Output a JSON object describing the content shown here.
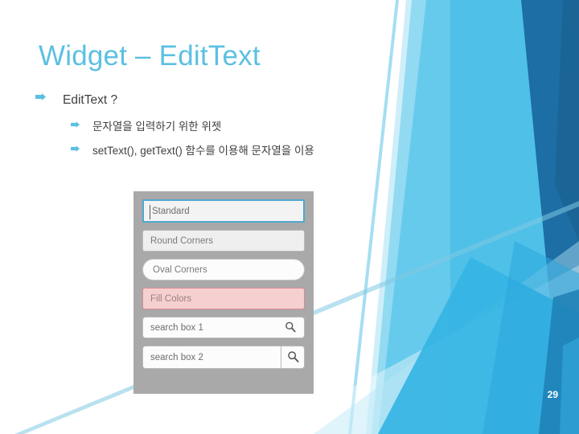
{
  "slide": {
    "title": "Widget – EditText",
    "page_number": "29",
    "title_color": "#5CC0E2",
    "accent_color": "#5CC0E2"
  },
  "bullets": [
    {
      "level": 1,
      "text": "EditText ?",
      "marker": "arrow-right-icon"
    },
    {
      "level": 2,
      "text": "문자열을 입력하기 위한 위젯",
      "marker": "arrow-right-icon"
    },
    {
      "level": 2,
      "text": "setText(), getText() 함수를 이용해 문자열을 이용",
      "marker": "arrow-right-icon"
    }
  ],
  "android_screenshot": {
    "panel_color": "#a9a9a9",
    "fields": [
      {
        "id": "standard",
        "label": "Standard",
        "style": "standard",
        "border_color": "#4fa8d0",
        "fill_color": "#f3f3f3",
        "has_caret": true,
        "has_search_icon": false
      },
      {
        "id": "round-corners",
        "label": "Round Corners",
        "style": "round",
        "border_color": "#b9b9b9",
        "fill_color": "#efefef",
        "has_caret": false,
        "has_search_icon": false
      },
      {
        "id": "oval-corners",
        "label": "Oval Corners",
        "style": "oval",
        "border_color": "#c2c2c2",
        "fill_color": "#fcfcfc",
        "has_caret": false,
        "has_search_icon": false
      },
      {
        "id": "fill-colors",
        "label": "Fill Colors",
        "style": "fill",
        "border_color": "#d98b91",
        "fill_color": "#f6cfd0",
        "has_caret": false,
        "has_search_icon": false
      },
      {
        "id": "search-box-1",
        "label": "search box 1",
        "style": "search-inline",
        "border_color": "#b9b9b9",
        "fill_color": "#fcfcfc",
        "has_caret": false,
        "has_search_icon": true
      },
      {
        "id": "search-box-2",
        "label": "search box 2",
        "style": "search-button",
        "border_color": "#b9b9b9",
        "fill_color": "#fcfcfc",
        "has_caret": false,
        "has_search_icon": true
      }
    ]
  }
}
